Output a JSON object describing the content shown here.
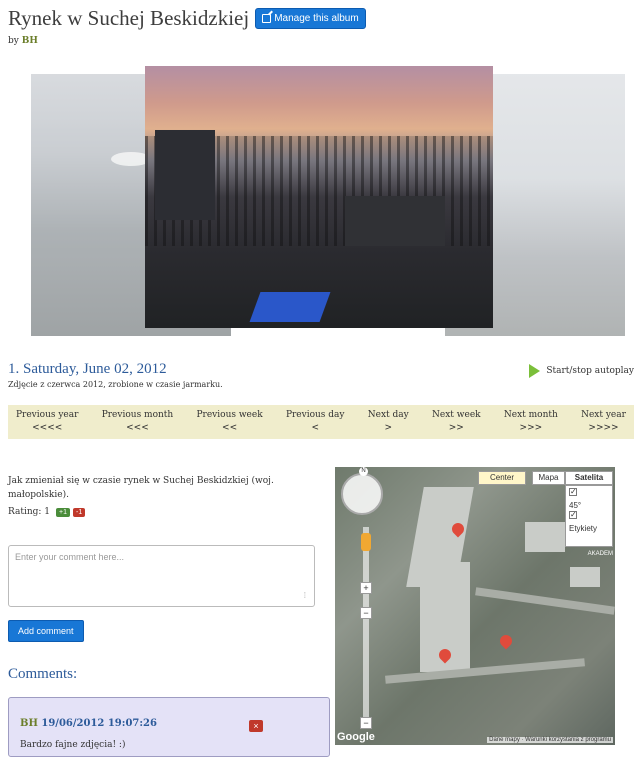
{
  "album": {
    "title": "Rynek w Suchej Beskidzkiej",
    "manage_label": "Manage this album",
    "by_prefix": "by",
    "author": "BH"
  },
  "photo": {
    "date_title": "1. Saturday, June 02, 2012",
    "caption": "Zdjęcie z czerwca 2012, zrobione w czasie jarmarku.",
    "autoplay_label": "Start/stop autoplay"
  },
  "nav": [
    {
      "label": "Previous year",
      "arrow": "<<<<"
    },
    {
      "label": "Previous month",
      "arrow": "<<<"
    },
    {
      "label": "Previous week",
      "arrow": "<<"
    },
    {
      "label": "Previous day",
      "arrow": "<"
    },
    {
      "label": "Next day",
      "arrow": ">"
    },
    {
      "label": "Next week",
      "arrow": ">>"
    },
    {
      "label": "Next month",
      "arrow": ">>>"
    },
    {
      "label": "Next year",
      "arrow": ">>>>"
    }
  ],
  "description": "Jak zmieniał się w czasie rynek w Suchej Beskidzkiej (woj. małopolskie).",
  "rating": {
    "label": "Rating: 1",
    "up": "+1",
    "down": "-1"
  },
  "comment_form": {
    "placeholder": "Enter your comment here...",
    "submit_label": "Add comment"
  },
  "comments": {
    "heading": "Comments:",
    "items": [
      {
        "author": "BH",
        "timestamp": "19/06/2012 19:07:26",
        "delete": "×",
        "text": "Bardzo fajne zdjęcia! :)"
      }
    ]
  },
  "map": {
    "north": "N",
    "center_label": "Center",
    "map_label": "Mapa",
    "satellite_label": "Satelita",
    "layer_45": "45°",
    "layer_labels": "Etykiety",
    "zoom_in": "+",
    "zoom_out": "−",
    "provider": "Google",
    "terms": "Dane mapy · Warunki korzystania z programu",
    "area_label": "AKADEM"
  }
}
